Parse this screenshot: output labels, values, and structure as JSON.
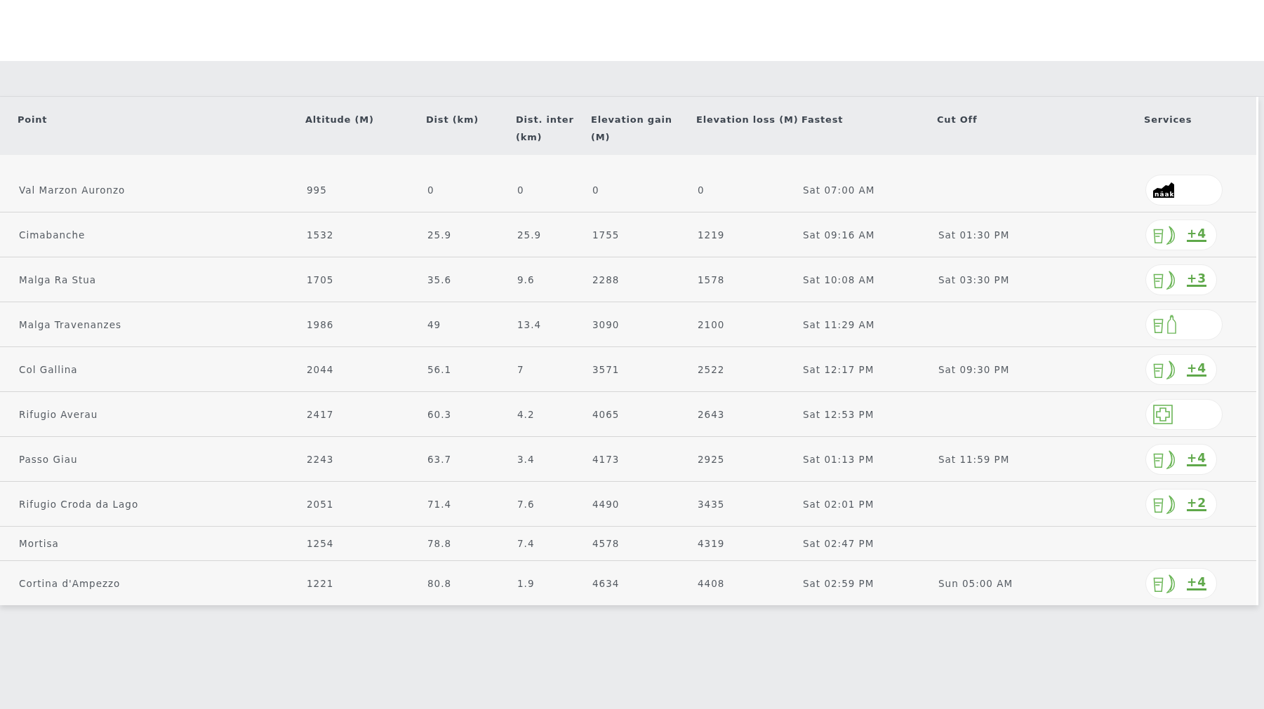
{
  "table": {
    "columns": [
      "Point",
      "Altitude (M)",
      "Dist (km)",
      "Dist. inter (km)",
      "Elevation gain (M)",
      "Elevation loss (M)",
      "Fastest",
      "Cut Off",
      "Services"
    ],
    "rows": [
      {
        "point": "Val Marzon Auronzo",
        "altitude": "995",
        "dist": "0",
        "dist_inter": "0",
        "elevation_gain": "0",
        "elevation_loss": "0",
        "fastest": "Sat 07:00 AM",
        "services": {
          "items": [
            {
              "kind": "logo",
              "text": "näak"
            }
          ]
        }
      },
      {
        "point": "Cimabanche",
        "altitude": "1532",
        "dist": "25.9",
        "dist_inter": "25.9",
        "elevation_gain": "1755",
        "elevation_loss": "1219",
        "fastest": "Sat 09:16 AM",
        "cut_off": "Sat 01:30 PM",
        "services": {
          "items": [
            {
              "kind": "cup"
            },
            {
              "kind": "banana"
            }
          ],
          "more": "+4"
        }
      },
      {
        "point": "Malga Ra Stua",
        "altitude": "1705",
        "dist": "35.6",
        "dist_inter": "9.6",
        "elevation_gain": "2288",
        "elevation_loss": "1578",
        "fastest": "Sat 10:08 AM",
        "cut_off": "Sat 03:30 PM",
        "services": {
          "items": [
            {
              "kind": "cup"
            },
            {
              "kind": "banana"
            }
          ],
          "more": "+3"
        }
      },
      {
        "point": "Malga Travenanzes",
        "altitude": "1986",
        "dist": "49",
        "dist_inter": "13.4",
        "elevation_gain": "3090",
        "elevation_loss": "2100",
        "fastest": "Sat 11:29 AM",
        "services": {
          "items": [
            {
              "kind": "cup"
            },
            {
              "kind": "bottle"
            }
          ]
        }
      },
      {
        "point": "Col Gallina",
        "altitude": "2044",
        "dist": "56.1",
        "dist_inter": "7",
        "elevation_gain": "3571",
        "elevation_loss": "2522",
        "fastest": "Sat 12:17 PM",
        "cut_off": "Sat 09:30 PM",
        "services": {
          "items": [
            {
              "kind": "cup"
            },
            {
              "kind": "banana"
            }
          ],
          "more": "+4"
        }
      },
      {
        "point": "Rifugio Averau",
        "altitude": "2417",
        "dist": "60.3",
        "dist_inter": "4.2",
        "elevation_gain": "4065",
        "elevation_loss": "2643",
        "fastest": "Sat 12:53 PM",
        "services": {
          "items": [
            {
              "kind": "first-aid"
            }
          ]
        }
      },
      {
        "point": "Passo Giau",
        "altitude": "2243",
        "dist": "63.7",
        "dist_inter": "3.4",
        "elevation_gain": "4173",
        "elevation_loss": "2925",
        "fastest": "Sat 01:13 PM",
        "cut_off": "Sat 11:59 PM",
        "services": {
          "items": [
            {
              "kind": "cup"
            },
            {
              "kind": "banana"
            }
          ],
          "more": "+4"
        }
      },
      {
        "point": "Rifugio Croda da Lago",
        "altitude": "2051",
        "dist": "71.4",
        "dist_inter": "7.6",
        "elevation_gain": "4490",
        "elevation_loss": "3435",
        "fastest": "Sat 02:01 PM",
        "services": {
          "items": [
            {
              "kind": "cup"
            },
            {
              "kind": "banana"
            }
          ],
          "more": "+2"
        }
      },
      {
        "point": "Mortisa",
        "altitude": "1254",
        "dist": "78.8",
        "dist_inter": "7.4",
        "elevation_gain": "4578",
        "elevation_loss": "4319",
        "fastest": "Sat 02:47 PM"
      },
      {
        "point": "Cortina d'Ampezzo",
        "altitude": "1221",
        "dist": "80.8",
        "dist_inter": "1.9",
        "elevation_gain": "4634",
        "elevation_loss": "4408",
        "fastest": "Sat 02:59 PM",
        "cut_off": "Sun 05:00 AM",
        "services": {
          "items": [
            {
              "kind": "cup"
            },
            {
              "kind": "banana"
            }
          ],
          "more": "+4"
        }
      }
    ]
  }
}
